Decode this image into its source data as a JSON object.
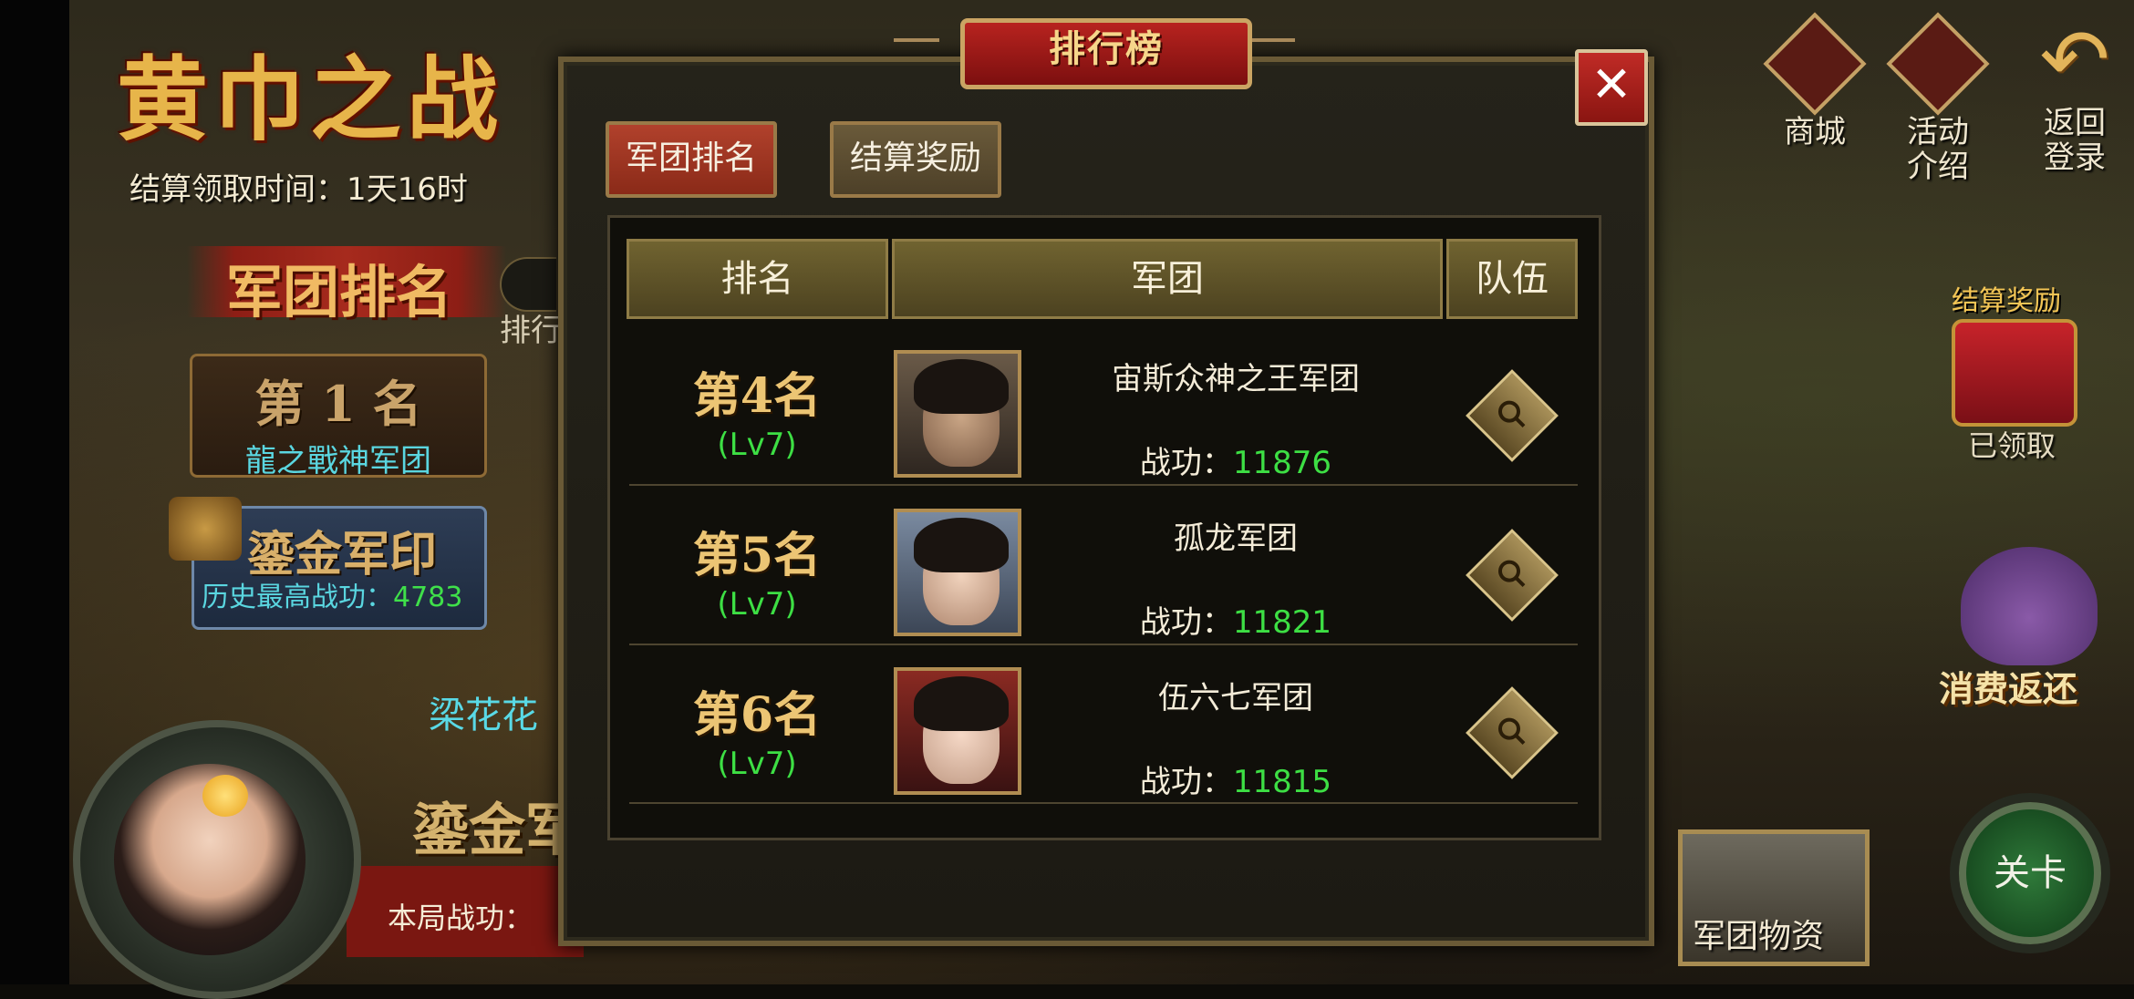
{
  "left_panel": {
    "event_title": "黄巾之战",
    "settle_time": "结算领取时间：1天16时",
    "rank_banner": "军团排名",
    "partial_tab_label": "排行",
    "first_place": {
      "rank": "第 1 名",
      "name": "龍之戰神军团"
    },
    "seal": {
      "title": "鎏金军印",
      "history_label": "历史最高战功：",
      "history_value": "4783"
    },
    "blue_text": "梁花花",
    "gold_text": "鎏金军",
    "bottom_label": "本局战功："
  },
  "right_panel": {
    "shop_label": "商城",
    "activity_label_1": "活动",
    "activity_label_2": "介绍",
    "return_label_1": "返回",
    "return_label_2": "登录",
    "reward_title": "结算奖励",
    "reward_status": "已领取",
    "rebate_label": "消费返还",
    "supplies_label": "军团物资",
    "level_label": "关卡"
  },
  "modal": {
    "title": "排行榜",
    "close_label": "✕",
    "tabs": [
      {
        "label": "军团排名",
        "active": true
      },
      {
        "label": "结算奖励",
        "active": false
      }
    ],
    "columns": [
      "排名",
      "军团",
      "队伍"
    ],
    "merit_label": "战功：",
    "rows": [
      {
        "rank": "第4名",
        "level": "(Lv7)",
        "corps": "宙斯众神之王军团",
        "merit": "11876"
      },
      {
        "rank": "第5名",
        "level": "(Lv7)",
        "corps": "孤龙军团",
        "merit": "11821"
      },
      {
        "rank": "第6名",
        "level": "(Lv7)",
        "corps": "伍六七军团",
        "merit": "11815"
      }
    ]
  },
  "colors": {
    "accent_red": "#b7231f",
    "gold": "#ecc574",
    "merit_green": "#3ddf44"
  }
}
